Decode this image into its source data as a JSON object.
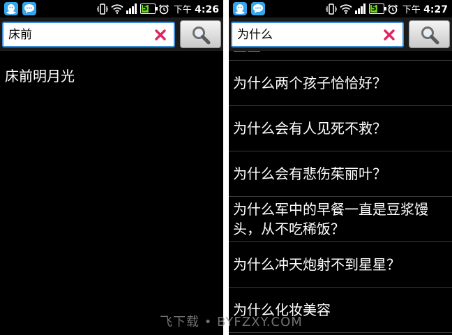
{
  "left_screen": {
    "status": {
      "ampm": "下午",
      "time": "4:26",
      "battery": "52"
    },
    "search": {
      "query": "床前"
    },
    "results": [
      "床前明月光"
    ]
  },
  "right_screen": {
    "status": {
      "ampm": "下午",
      "time": "4:27",
      "battery": "52"
    },
    "search": {
      "query": "为什么"
    },
    "partial_item": "——",
    "results": [
      "为什么两个孩子恰恰好？",
      "为什么会有人见死不救？",
      "为什么会有悲伤茱丽叶？",
      "为什么军中的早餐一直是豆浆馒头，从不吃稀饭？",
      "为什么冲天炮射不到星星？",
      "为什么化妆美容"
    ]
  },
  "watermark": "飞下载 • BYFZXY.COM",
  "icons": {
    "notification_1": "qq-icon",
    "notification_2": "chat-bubble-icon",
    "vibrate": "vibrate-icon",
    "wifi": "wifi-icon",
    "signal": "signal-icon",
    "battery": "battery-icon",
    "alarm": "alarm-icon",
    "clear": "clear-x-icon",
    "search": "magnifier-icon"
  },
  "colors": {
    "accent_blue": "#3f8fd6",
    "notification_blue": "#36a6ec",
    "battery_green": "#6bd521",
    "clear_red": "#e0245e"
  }
}
